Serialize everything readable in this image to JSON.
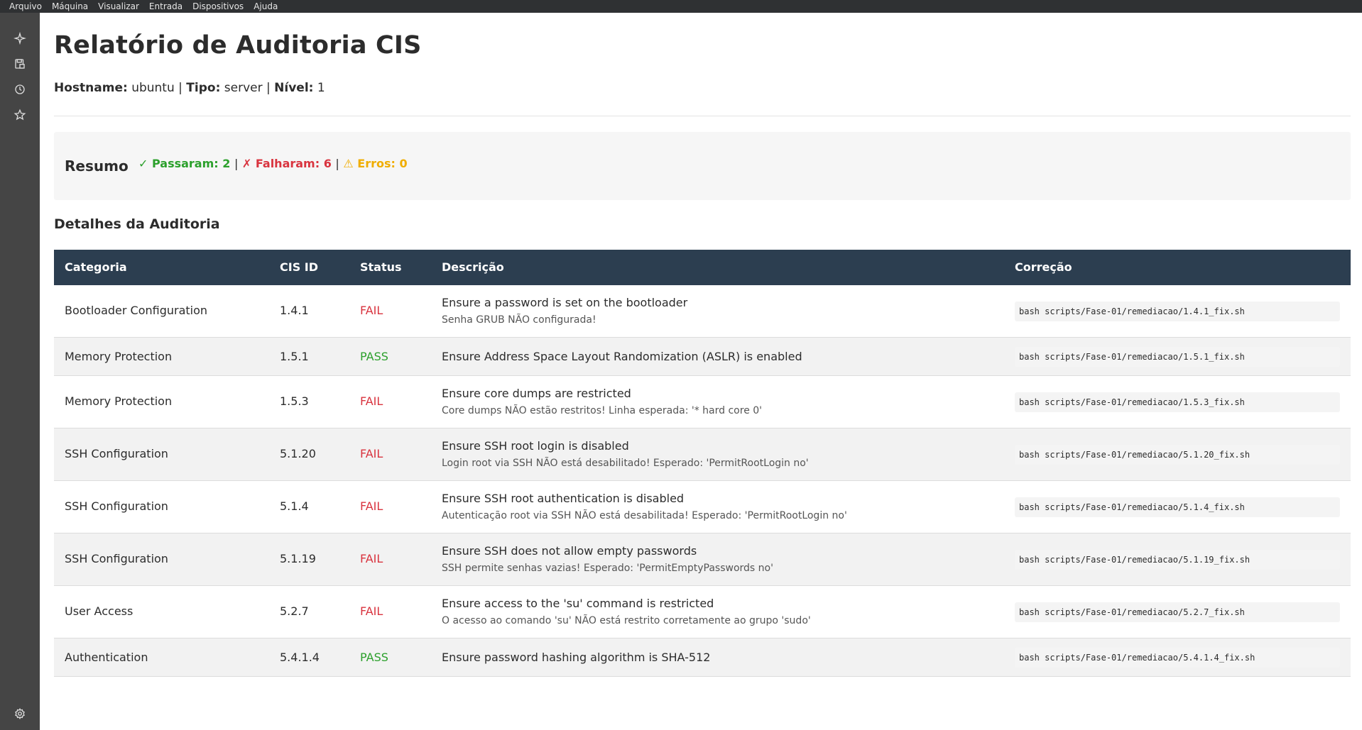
{
  "menubar": {
    "items": [
      "Arquivo",
      "Máquina",
      "Visualizar",
      "Entrada",
      "Dispositivos",
      "Ajuda"
    ]
  },
  "sidebar": {
    "icons": [
      "sparkle-icon",
      "save-icon",
      "history-icon",
      "star-icon",
      "gear-icon"
    ]
  },
  "report": {
    "title": "Relatório de Auditoria CIS",
    "hostname_label": "Hostname:",
    "hostname": "ubuntu",
    "tipo_label": "Tipo:",
    "tipo": "server",
    "nivel_label": "Nível:",
    "nivel": "1"
  },
  "summary": {
    "title": "Resumo",
    "passed": "✓ Passaram: 2",
    "failed": "✗ Falharam: 6",
    "errors": "⚠ Erros: 0"
  },
  "details": {
    "title": "Detalhes da Auditoria",
    "columns": [
      "Categoria",
      "CIS ID",
      "Status",
      "Descrição",
      "Correção"
    ],
    "rows": [
      {
        "category": "Bootloader Configuration",
        "cis_id": "1.4.1",
        "status": "FAIL",
        "description": "Ensure a password is set on the bootloader",
        "detail": "Senha GRUB NÃO configurada!",
        "fix": "bash scripts/Fase-01/remediacao/1.4.1_fix.sh"
      },
      {
        "category": "Memory Protection",
        "cis_id": "1.5.1",
        "status": "PASS",
        "description": "Ensure Address Space Layout Randomization (ASLR) is enabled",
        "detail": "",
        "fix": "bash scripts/Fase-01/remediacao/1.5.1_fix.sh"
      },
      {
        "category": "Memory Protection",
        "cis_id": "1.5.3",
        "status": "FAIL",
        "description": "Ensure core dumps are restricted",
        "detail": "Core dumps NÃO estão restritos! Linha esperada: '* hard core 0'",
        "fix": "bash scripts/Fase-01/remediacao/1.5.3_fix.sh"
      },
      {
        "category": "SSH Configuration",
        "cis_id": "5.1.20",
        "status": "FAIL",
        "description": "Ensure SSH root login is disabled",
        "detail": "Login root via SSH NÃO está desabilitado! Esperado: 'PermitRootLogin no'",
        "fix": "bash scripts/Fase-01/remediacao/5.1.20_fix.sh"
      },
      {
        "category": "SSH Configuration",
        "cis_id": "5.1.4",
        "status": "FAIL",
        "description": "Ensure SSH root authentication is disabled",
        "detail": "Autenticação root via SSH NÃO está desabilitada! Esperado: 'PermitRootLogin no'",
        "fix": "bash scripts/Fase-01/remediacao/5.1.4_fix.sh"
      },
      {
        "category": "SSH Configuration",
        "cis_id": "5.1.19",
        "status": "FAIL",
        "description": "Ensure SSH does not allow empty passwords",
        "detail": "SSH permite senhas vazias! Esperado: 'PermitEmptyPasswords no'",
        "fix": "bash scripts/Fase-01/remediacao/5.1.19_fix.sh"
      },
      {
        "category": "User Access",
        "cis_id": "5.2.7",
        "status": "FAIL",
        "description": "Ensure access to the 'su' command is restricted",
        "detail": "O acesso ao comando 'su' NÃO está restrito corretamente ao grupo 'sudo'",
        "fix": "bash scripts/Fase-01/remediacao/5.2.7_fix.sh"
      },
      {
        "category": "Authentication",
        "cis_id": "5.4.1.4",
        "status": "PASS",
        "description": "Ensure password hashing algorithm is SHA-512",
        "detail": "",
        "fix": "bash scripts/Fase-01/remediacao/5.4.1.4_fix.sh"
      }
    ]
  },
  "colors": {
    "header_bg": "#2c3e50",
    "pass": "#2ca02c",
    "fail": "#d9343f",
    "error": "#f0ad00"
  }
}
